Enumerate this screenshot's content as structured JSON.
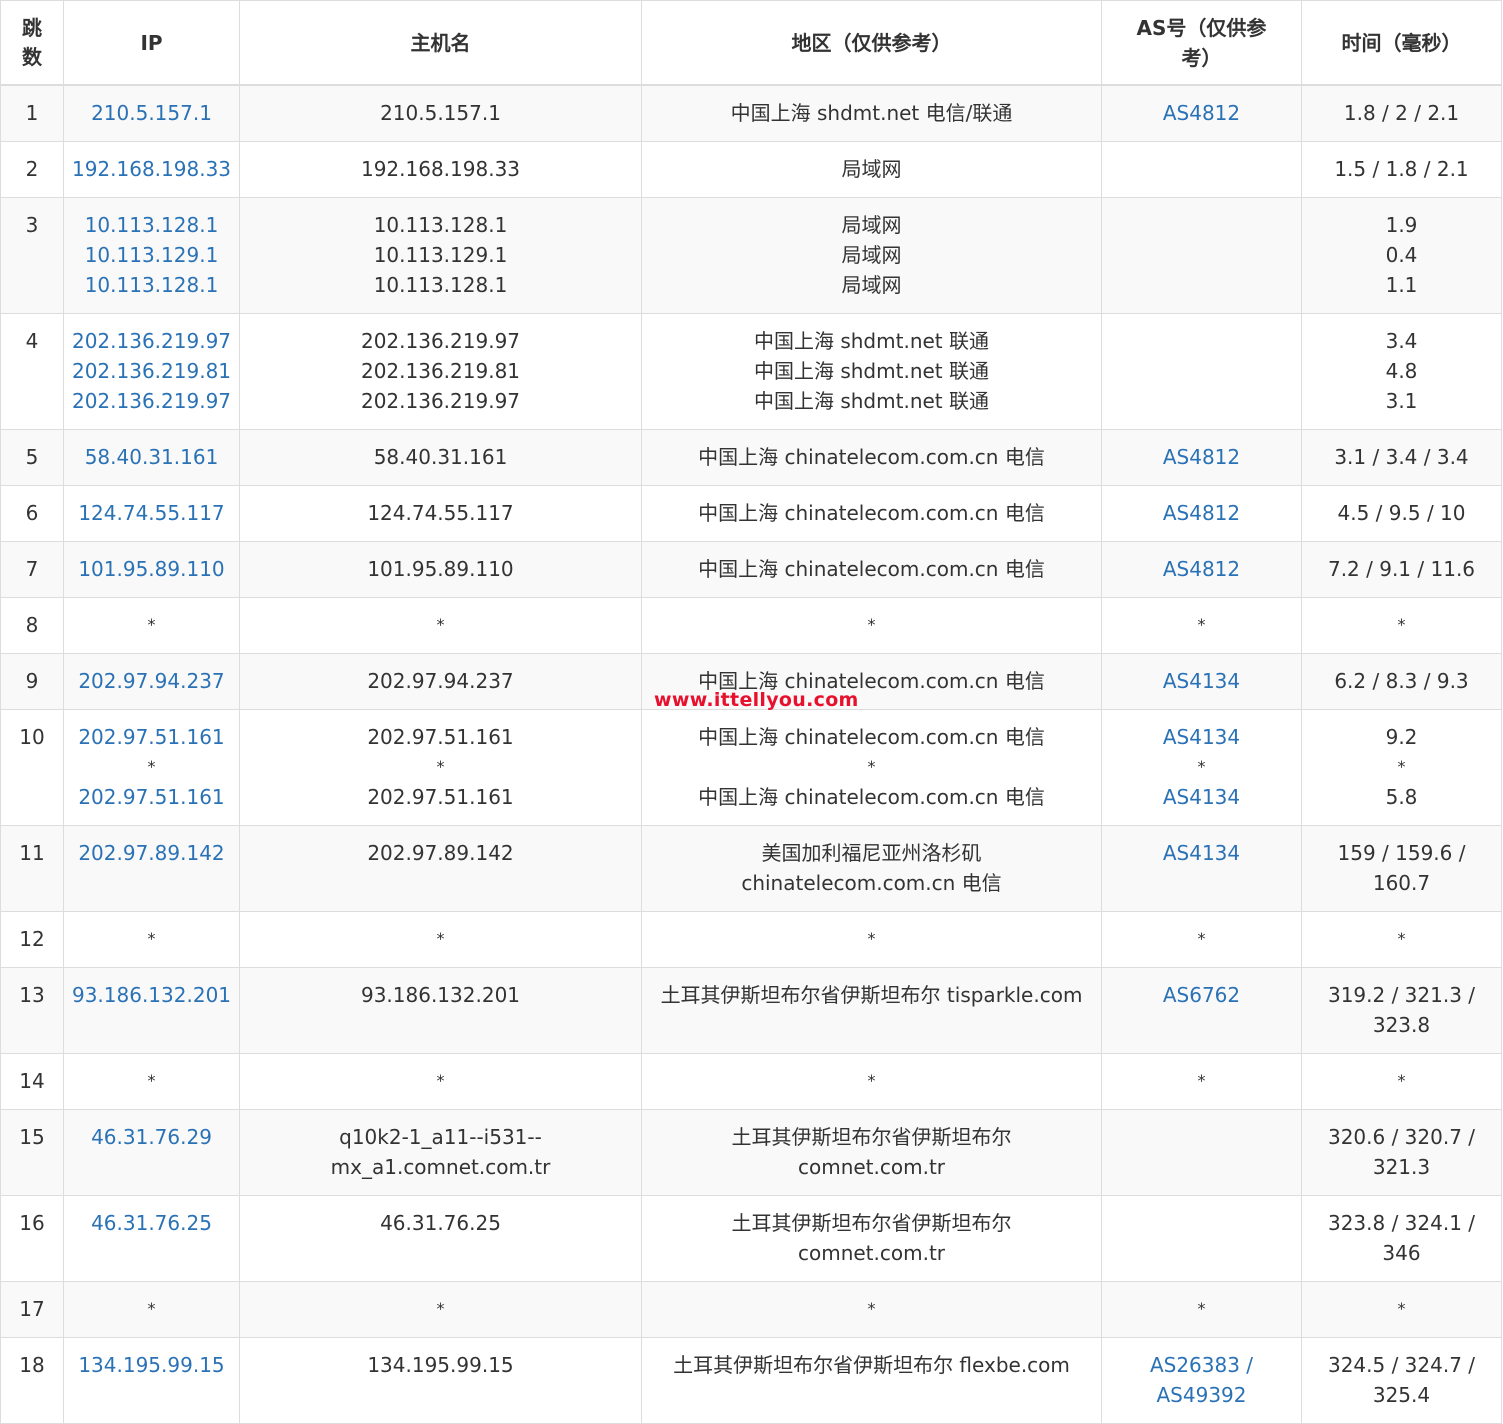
{
  "columns": [
    "跳数",
    "IP",
    "主机名",
    "地区（仅供参考）",
    "AS号（仅供参考）",
    "时间（毫秒）"
  ],
  "rows": [
    {
      "hop": "1",
      "ip": [
        "210.5.157.1"
      ],
      "host": [
        "210.5.157.1"
      ],
      "region": [
        "中国上海 shdmt.net 电信/联通"
      ],
      "as": [
        "AS4812"
      ],
      "time": [
        "1.8 / 2 / 2.1"
      ]
    },
    {
      "hop": "2",
      "ip": [
        "192.168.198.33"
      ],
      "host": [
        "192.168.198.33"
      ],
      "region": [
        "局域网"
      ],
      "as": [],
      "time": [
        "1.5 / 1.8 / 2.1"
      ]
    },
    {
      "hop": "3",
      "ip": [
        "10.113.128.1",
        "10.113.129.1",
        "10.113.128.1"
      ],
      "host": [
        "10.113.128.1",
        "10.113.129.1",
        "10.113.128.1"
      ],
      "region": [
        "局域网",
        "局域网",
        "局域网"
      ],
      "as": [],
      "time": [
        "1.9",
        "0.4",
        "1.1"
      ]
    },
    {
      "hop": "4",
      "ip": [
        "202.136.219.97",
        "202.136.219.81",
        "202.136.219.97"
      ],
      "host": [
        "202.136.219.97",
        "202.136.219.81",
        "202.136.219.97"
      ],
      "region": [
        "中国上海 shdmt.net 联通",
        "中国上海 shdmt.net 联通",
        "中国上海 shdmt.net 联通"
      ],
      "as": [],
      "time": [
        "3.4",
        "4.8",
        "3.1"
      ]
    },
    {
      "hop": "5",
      "ip": [
        "58.40.31.161"
      ],
      "host": [
        "58.40.31.161"
      ],
      "region": [
        "中国上海 chinatelecom.com.cn 电信"
      ],
      "as": [
        "AS4812"
      ],
      "time": [
        "3.1 / 3.4 / 3.4"
      ]
    },
    {
      "hop": "6",
      "ip": [
        "124.74.55.117"
      ],
      "host": [
        "124.74.55.117"
      ],
      "region": [
        "中国上海 chinatelecom.com.cn 电信"
      ],
      "as": [
        "AS4812"
      ],
      "time": [
        "4.5 / 9.5 / 10"
      ]
    },
    {
      "hop": "7",
      "ip": [
        "101.95.89.110"
      ],
      "host": [
        "101.95.89.110"
      ],
      "region": [
        "中国上海 chinatelecom.com.cn 电信"
      ],
      "as": [
        "AS4812"
      ],
      "time": [
        "7.2 / 9.1 / 11.6"
      ]
    },
    {
      "hop": "8",
      "ip": [
        "*"
      ],
      "host": [
        "*"
      ],
      "region": [
        "*"
      ],
      "as": [
        "*"
      ],
      "time": [
        "*"
      ]
    },
    {
      "hop": "9",
      "ip": [
        "202.97.94.237"
      ],
      "host": [
        "202.97.94.237"
      ],
      "region": [
        "中国上海 chinatelecom.com.cn 电信"
      ],
      "as": [
        "AS4134"
      ],
      "time": [
        "6.2 / 8.3 / 9.3"
      ]
    },
    {
      "hop": "10",
      "ip": [
        "202.97.51.161",
        "*",
        "202.97.51.161"
      ],
      "host": [
        "202.97.51.161",
        "*",
        "202.97.51.161"
      ],
      "region": [
        "中国上海 chinatelecom.com.cn 电信",
        "*",
        "中国上海 chinatelecom.com.cn 电信"
      ],
      "as": [
        "AS4134",
        "*",
        "AS4134"
      ],
      "time": [
        "9.2",
        "*",
        "5.8"
      ]
    },
    {
      "hop": "11",
      "ip": [
        "202.97.89.142"
      ],
      "host": [
        "202.97.89.142"
      ],
      "region": [
        "美国加利福尼亚州洛杉矶",
        "chinatelecom.com.cn 电信"
      ],
      "as": [
        "AS4134"
      ],
      "time": [
        "159 / 159.6 /",
        "160.7"
      ]
    },
    {
      "hop": "12",
      "ip": [
        "*"
      ],
      "host": [
        "*"
      ],
      "region": [
        "*"
      ],
      "as": [
        "*"
      ],
      "time": [
        "*"
      ]
    },
    {
      "hop": "13",
      "ip": [
        "93.186.132.201"
      ],
      "host": [
        "93.186.132.201"
      ],
      "region": [
        "土耳其伊斯坦布尔省伊斯坦布尔 tisparkle.com"
      ],
      "as": [
        "AS6762"
      ],
      "time": [
        "319.2 / 321.3 /",
        "323.8"
      ]
    },
    {
      "hop": "14",
      "ip": [
        "*"
      ],
      "host": [
        "*"
      ],
      "region": [
        "*"
      ],
      "as": [
        "*"
      ],
      "time": [
        "*"
      ]
    },
    {
      "hop": "15",
      "ip": [
        "46.31.76.29"
      ],
      "host": [
        "q10k2-1_a11--i531--",
        "mx_a1.comnet.com.tr"
      ],
      "region": [
        "土耳其伊斯坦布尔省伊斯坦布尔",
        "comnet.com.tr"
      ],
      "as": [],
      "time": [
        "320.6 / 320.7 /",
        "321.3"
      ]
    },
    {
      "hop": "16",
      "ip": [
        "46.31.76.25"
      ],
      "host": [
        "46.31.76.25"
      ],
      "region": [
        "土耳其伊斯坦布尔省伊斯坦布尔",
        "comnet.com.tr"
      ],
      "as": [],
      "time": [
        "323.8 / 324.1 /",
        "346"
      ]
    },
    {
      "hop": "17",
      "ip": [
        "*"
      ],
      "host": [
        "*"
      ],
      "region": [
        "*"
      ],
      "as": [
        "*"
      ],
      "time": [
        "*"
      ]
    },
    {
      "hop": "18",
      "ip": [
        "134.195.99.15"
      ],
      "host": [
        "134.195.99.15"
      ],
      "region": [
        "土耳其伊斯坦布尔省伊斯坦布尔 flexbe.com"
      ],
      "as": [
        "AS26383 /",
        "AS49392"
      ],
      "time": [
        "324.5 / 324.7 /",
        "325.4"
      ]
    }
  ],
  "watermark": "www.ittellyou.com",
  "colors": {
    "link": "#2a72b5",
    "border": "#dddddd",
    "stripe": "#f9f9f9",
    "watermark": "#e8112d"
  }
}
